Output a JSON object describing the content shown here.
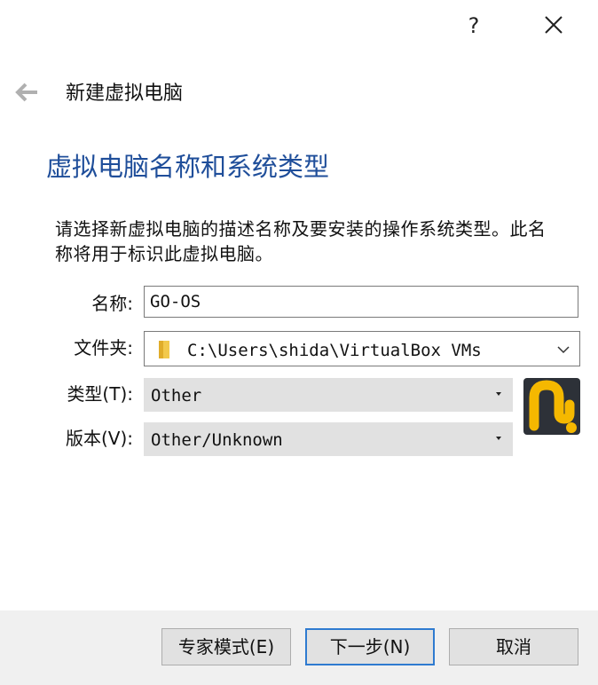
{
  "titlebar": {
    "help_label": "?",
    "icons": {
      "help": "question-mark-icon",
      "close": "close-icon"
    }
  },
  "header": {
    "back_icon": "back-arrow-icon",
    "title": "新建虚拟电脑"
  },
  "section": {
    "heading": "虚拟电脑名称和系统类型",
    "description": "请选择新虚拟电脑的描述名称及要安装的操作系统类型。此名称将用于标识此虚拟电脑。"
  },
  "form": {
    "name_label": "名称:",
    "name_value": "GO-OS",
    "folder_label": "文件夹:",
    "folder_value": "C:\\Users\\shida\\VirtualBox VMs",
    "folder_icon": "folder-icon",
    "type_label": "类型(T):",
    "type_value": "Other",
    "version_label": "版本(V):",
    "version_value": "Other/Unknown",
    "os_icon": "os-other-icon"
  },
  "footer": {
    "expert_mode_label": "专家模式(E)",
    "next_label": "下一步(N)",
    "cancel_label": "取消"
  },
  "colors": {
    "heading": "#1f4e9a",
    "focus_border": "#2f7bd0",
    "footer_bg": "#f0f0f0",
    "combo_bg": "#e1e1e1",
    "os_icon_yellow": "#f5b800"
  }
}
